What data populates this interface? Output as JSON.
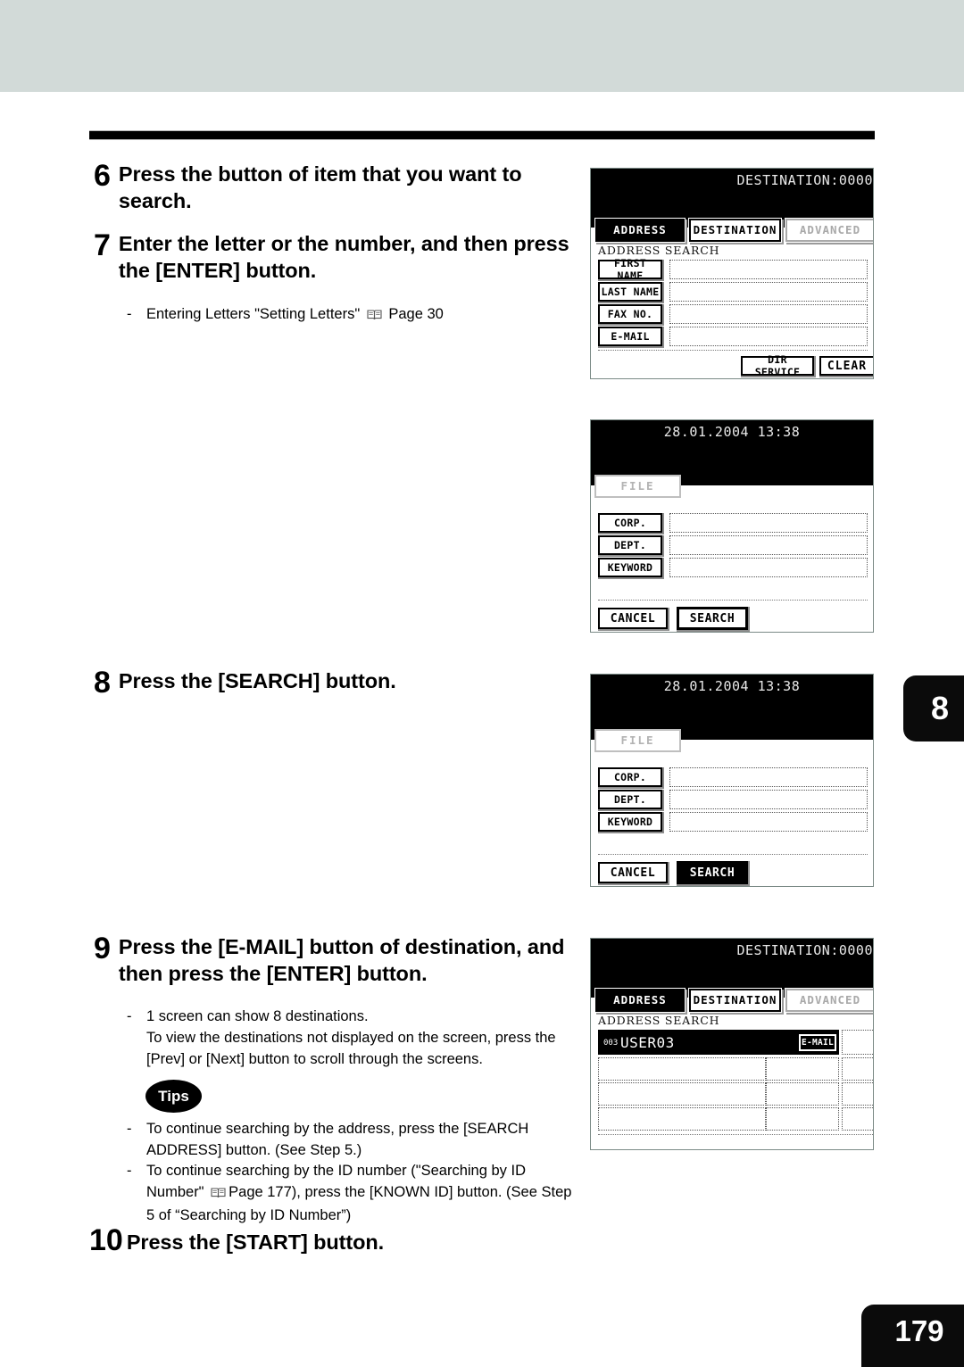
{
  "page": {
    "number": "179",
    "chapter_tab": "8"
  },
  "steps": [
    {
      "number": "6",
      "text": "Press the button of item that you want to search."
    },
    {
      "number": "7",
      "text": "Enter the letter or the number, and then press the [ENTER] button."
    },
    {
      "number": "8",
      "text": "Press the [SEARCH] button."
    },
    {
      "number": "9",
      "text": "Press the [E-MAIL] button of destination, and then press the [ENTER] button."
    },
    {
      "number": "10",
      "text": "Press the [START] button."
    }
  ],
  "notes": {
    "step7_note": "Entering Letters \"Setting Letters\"",
    "step7_note_page": "Page 30",
    "step9_note_line1": "1 screen can show 8 destinations.",
    "step9_note_line2": "To view the destinations not displayed on the screen, press the",
    "step9_note_line3": "[Prev] or [Next] button to scroll through the screens."
  },
  "tips": {
    "badge": "Tips",
    "items": [
      {
        "line1": "To continue searching by the address, press the [SEARCH",
        "line2": "ADDRESS] button. (See Step 5.)"
      },
      {
        "line1": "To continue searching by the ID number (\"Searching by ID",
        "line2_pre": "Number\"",
        "line2_page": "Page 177",
        "line2_post": "), press the [KNOWN ID] button. (See Step",
        "line3": "5 of “Searching by ID Number”)"
      }
    ]
  },
  "panels": {
    "address_search": {
      "status": "DESTINATION:0000",
      "tabs": [
        {
          "label": "ADDRESS",
          "state": "selected"
        },
        {
          "label": "DESTINATION",
          "state": "normal"
        },
        {
          "label": "ADVANCED",
          "state": "disabled"
        }
      ],
      "section_label": "ADDRESS SEARCH",
      "fields": [
        {
          "label": "FIRST NAME",
          "value": ""
        },
        {
          "label": "LAST NAME",
          "value": ""
        },
        {
          "label": "FAX NO.",
          "value": ""
        },
        {
          "label": "E-MAIL",
          "value": ""
        }
      ],
      "actions": [
        {
          "label": "DIR SERVICE",
          "state": "normal"
        },
        {
          "label": "CLEAR",
          "state": "normal"
        }
      ]
    },
    "file_search": {
      "datetime": "28.01.2004 13:38",
      "tab": "FILE",
      "fields": [
        {
          "label": "CORP.",
          "value": ""
        },
        {
          "label": "DEPT.",
          "value": ""
        },
        {
          "label": "KEYWORD",
          "value": ""
        }
      ],
      "actions": [
        {
          "label": "CANCEL",
          "state": "normal"
        },
        {
          "label": "SEARCH",
          "state": "normal"
        }
      ]
    },
    "file_search_pressed": {
      "datetime": "28.01.2004 13:38",
      "tab": "FILE",
      "fields": [
        {
          "label": "CORP.",
          "value": ""
        },
        {
          "label": "DEPT.",
          "value": ""
        },
        {
          "label": "KEYWORD",
          "value": ""
        }
      ],
      "actions": [
        {
          "label": "CANCEL",
          "state": "normal"
        },
        {
          "label": "SEARCH",
          "state": "pressed"
        }
      ]
    },
    "search_results": {
      "status": "DESTINATION:0000",
      "tabs": [
        {
          "label": "ADDRESS",
          "state": "selected"
        },
        {
          "label": "DESTINATION",
          "state": "normal"
        },
        {
          "label": "ADVANCED",
          "state": "disabled"
        }
      ],
      "section_label": "ADDRESS SEARCH",
      "rows": [
        {
          "index": "003",
          "name": "USER03",
          "button": "E-MAIL",
          "state": "selected"
        },
        {
          "index": "",
          "name": "",
          "button": "",
          "state": "empty"
        },
        {
          "index": "",
          "name": "",
          "button": "",
          "state": "empty"
        },
        {
          "index": "",
          "name": "",
          "button": "",
          "state": "empty"
        }
      ]
    }
  },
  "colors": {
    "header_band": "#d2dad8",
    "lcd_bg": "#000000",
    "lcd_text": "#e9e9e9",
    "tab_black": "#0b0b0b"
  }
}
